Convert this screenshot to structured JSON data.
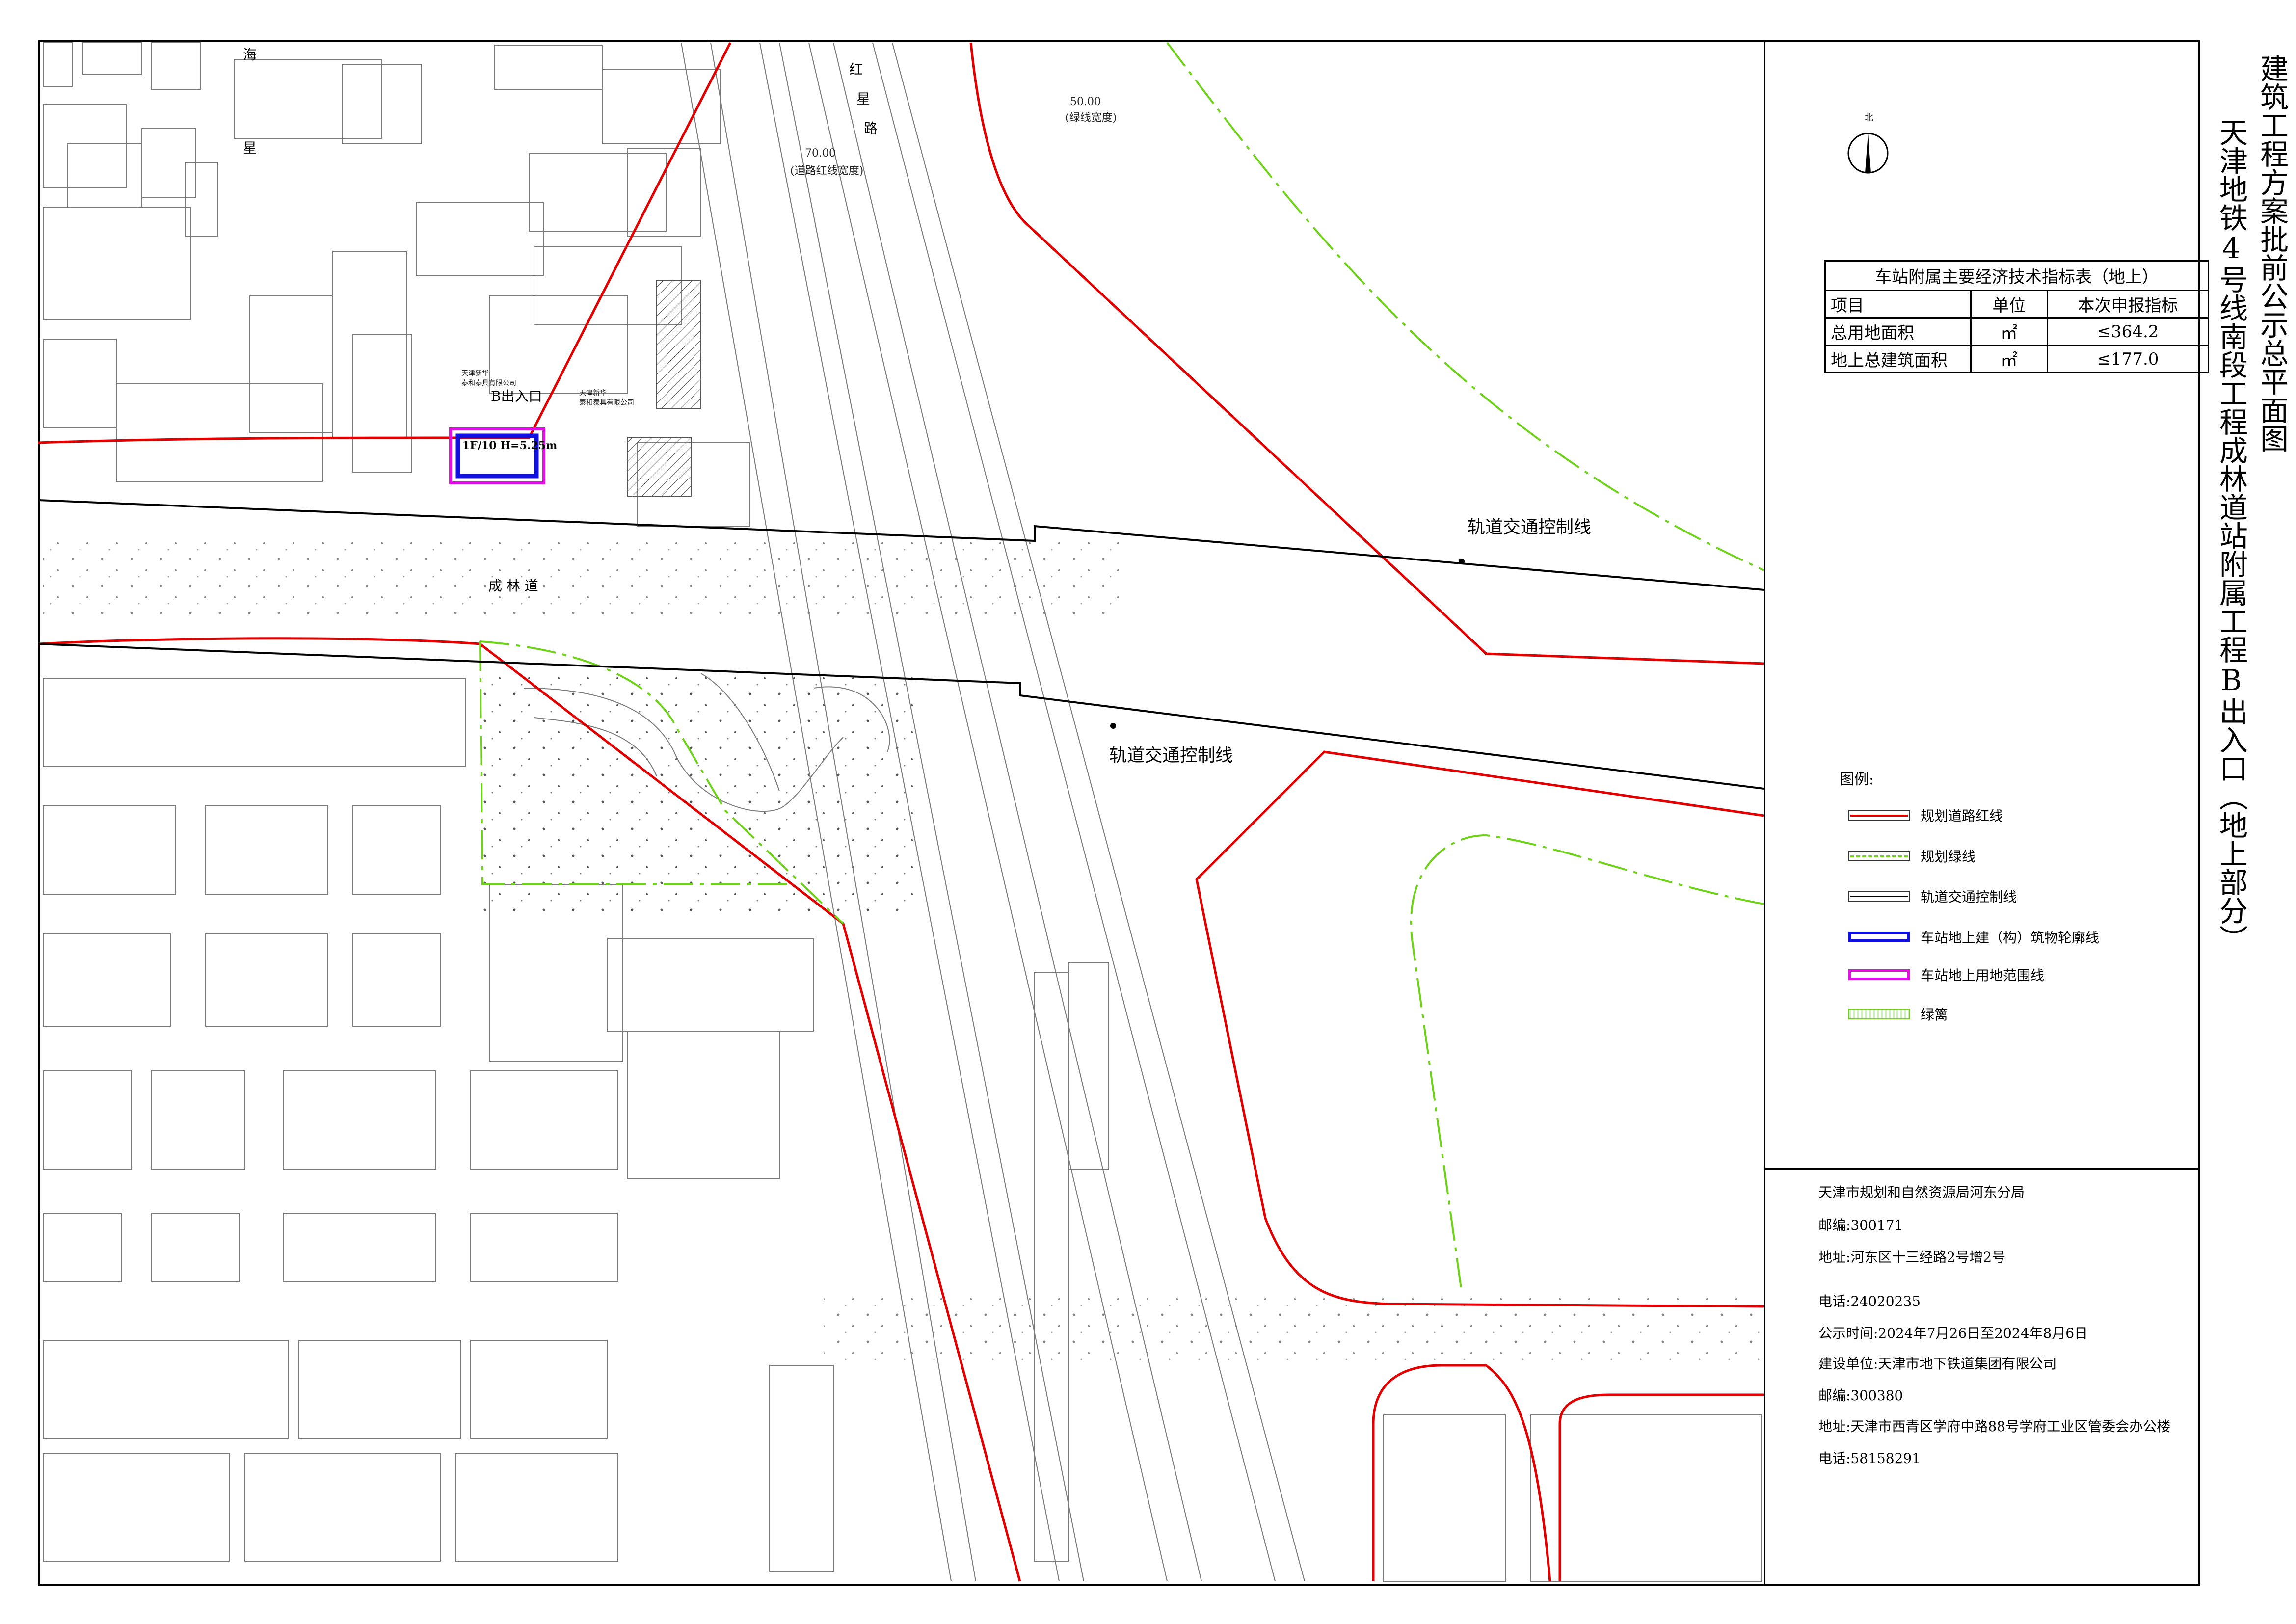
{
  "title_left": "天津地铁4号线南段工程成林道站附属工程B出入口（地上部分）",
  "title_right": "建筑工程方案批前公示总平面图",
  "table": {
    "caption": "车站附属主要经济技术指标表（地上）",
    "headers": [
      "项目",
      "单位",
      "本次申报指标"
    ],
    "rows": [
      {
        "item": "总用地面积",
        "unit": "㎡",
        "value": "≤364.2"
      },
      {
        "item": "地上总建筑面积",
        "unit": "㎡",
        "value": "≤177.0"
      }
    ]
  },
  "legend": {
    "title": "图例:",
    "items": [
      {
        "label": "规划道路红线",
        "color": "#e00000",
        "style": "solid-red"
      },
      {
        "label": "规划绿线",
        "color": "#6fd21a",
        "style": "dashdot-green"
      },
      {
        "label": "轨道交通控制线",
        "color": "#000000",
        "style": "thin-black"
      },
      {
        "label": "车站地上建（构）筑物轮廓线",
        "color": "#1010e0",
        "style": "thick-blue"
      },
      {
        "label": "车站地上用地范围线",
        "color": "#e010e0",
        "style": "magenta"
      },
      {
        "label": "绿篱",
        "color": "#6fd21a",
        "style": "hedge"
      }
    ]
  },
  "info": {
    "authority": "天津市规划和自然资源局河东分局",
    "postcode1": "邮编:300171",
    "address1": "地址:河东区十三经路2号增2号",
    "phone1": "电话:24020235",
    "period": "公示时间:2024年7月26日至2024年8月6日",
    "builder": "建设单位:天津市地下铁道集团有限公司",
    "postcode2": "邮编:300380",
    "address2": "地址:天津市西青区学府中路88号学府工业区管委会办公楼",
    "phone2": "电话:58158291"
  },
  "map": {
    "control_line_label_1": "轨道交通控制线",
    "control_line_label_2": "轨道交通控制线",
    "exit_label": "B出入口",
    "building_label": "1F/10  H=5.25m",
    "road_chenglin": "成  林  道",
    "road_hongxing_1": "红",
    "road_hongxing_2": "星",
    "road_hongxing_3": "路",
    "road_width_label": "(道路红线宽度)",
    "road_width_value": "70.00",
    "green_width_label": "(绿线宽度)",
    "green_width_value": "50.00",
    "road_hai_1": "海",
    "road_hai_2": "星",
    "company_1": "天津新华\n泰和泰具有限公司",
    "company_2": "天津新华\n泰和泰具有限公司",
    "north_label": "北"
  },
  "colors": {
    "red_line": "#e00000",
    "green_line": "#6fd21a",
    "blue_outline": "#1010e0",
    "magenta_outline": "#e010e0",
    "base_gray": "#7a7a7a"
  }
}
